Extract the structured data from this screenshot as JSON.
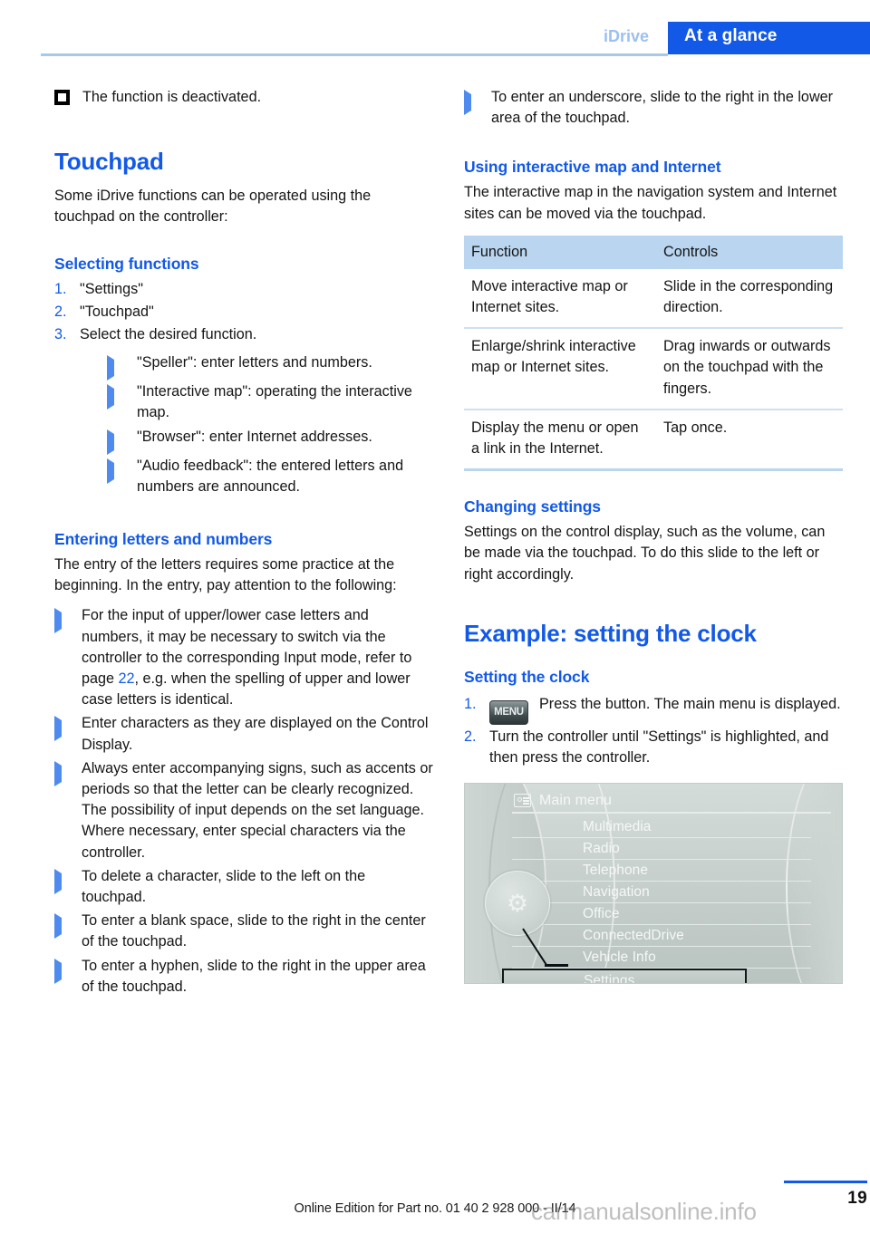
{
  "header": {
    "section": "iDrive",
    "tab": "At a glance"
  },
  "left_column": {
    "deactivated_note": "The function is deactivated.",
    "touchpad_heading": "Touchpad",
    "touchpad_intro": "Some iDrive functions can be operated using the touchpad on the controller:",
    "selecting_functions_heading": "Selecting functions",
    "selecting_steps": [
      {
        "num": "1.",
        "text": "\"Settings\""
      },
      {
        "num": "2.",
        "text": "\"Touchpad\""
      },
      {
        "num": "3.",
        "text": "Select the desired function."
      }
    ],
    "selecting_substeps": [
      "\"Speller\": enter letters and numbers.",
      "\"Interactive map\": operating the inter­active map.",
      "\"Browser\": enter Internet addresses.",
      "\"Audio feedback\": the entered letters and numbers are announced."
    ],
    "entering_heading": "Entering letters and numbers",
    "entering_intro": "The entry of the letters requires some practice at the beginning. In the entry, pay attention to the following:",
    "entering_bullets": [
      {
        "text_before": "For the input of upper/lower case letters and numbers, it may be necessary to switch via the controller to the corresponding Input mode, refer to page ",
        "page_ref": "22",
        "text_after": ", e.g. when the spelling of upper and lower case letters is identical."
      },
      {
        "text_before": "Enter characters as they are displayed on the Control Display.",
        "page_ref": "",
        "text_after": ""
      },
      {
        "text_before": "Always enter accompanying signs, such as accents or periods so that the letter can be clearly recognized. The possibility of input depends on the set language. Where necessary, enter special characters via the controller.",
        "page_ref": "",
        "text_after": ""
      },
      {
        "text_before": "To delete a character, slide to the left on the touchpad.",
        "page_ref": "",
        "text_after": ""
      },
      {
        "text_before": "To enter a blank space, slide to the right in the center of the touchpad.",
        "page_ref": "",
        "text_after": ""
      },
      {
        "text_before": "To enter a hyphen, slide to the right in the upper area of the touchpad.",
        "page_ref": "",
        "text_after": ""
      }
    ]
  },
  "right_column": {
    "underscore_bullet": "To enter an underscore, slide to the right in the lower area of the touchpad.",
    "using_map_heading": "Using interactive map and Internet",
    "using_map_intro": "The interactive map in the navigation system and Internet sites can be moved via the touchpad.",
    "table": {
      "headers": [
        "Function",
        "Controls"
      ],
      "rows": [
        [
          "Move interactive map or Internet sites.",
          "Slide in the corresponding direction."
        ],
        [
          "Enlarge/shrink interactive map or Internet sites.",
          "Drag inwards or outwards on the touchpad with the fingers."
        ],
        [
          "Display the menu or open a link in the Internet.",
          "Tap once."
        ]
      ]
    },
    "changing_settings_heading": "Changing settings",
    "changing_settings_text": "Settings on the control display, such as the volume, can be made via the touchpad. To do this slide to the left or right accordingly.",
    "example_heading": "Example: setting the clock",
    "setting_clock_heading": "Setting the clock",
    "clock_steps": [
      {
        "num": "1.",
        "icon": "menu-button-icon",
        "icon_label": "MENU",
        "text": "Press the button. The main menu is displayed."
      },
      {
        "num": "2.",
        "icon": "",
        "icon_label": "",
        "text": "Turn the controller until \"Settings\" is highlighted, and then press the controller."
      }
    ],
    "idrive_screen": {
      "title": "Main menu",
      "title_icon": "menu-list-icon",
      "knob_icon": "gear-icon",
      "items": [
        {
          "label": "Multimedia",
          "highlighted": false
        },
        {
          "label": "Radio",
          "highlighted": false
        },
        {
          "label": "Telephone",
          "highlighted": false
        },
        {
          "label": "Navigation",
          "highlighted": false
        },
        {
          "label": "Office",
          "highlighted": false
        },
        {
          "label": "ConnectedDrive",
          "highlighted": false
        },
        {
          "label": "Vehicle Info",
          "highlighted": false
        },
        {
          "label": "Settings",
          "highlighted": true
        }
      ]
    }
  },
  "footer": {
    "edition": "Online Edition for Part no. 01 40 2 928 000 - II/14",
    "page_number": "19",
    "watermark": "carmanualsonline.info"
  },
  "colors": {
    "brand_blue": "#1259e8",
    "header_rule": "#a8c8e8",
    "table_header_bg": "#b9d5ef",
    "bullet_blue": "#4f8bee"
  }
}
